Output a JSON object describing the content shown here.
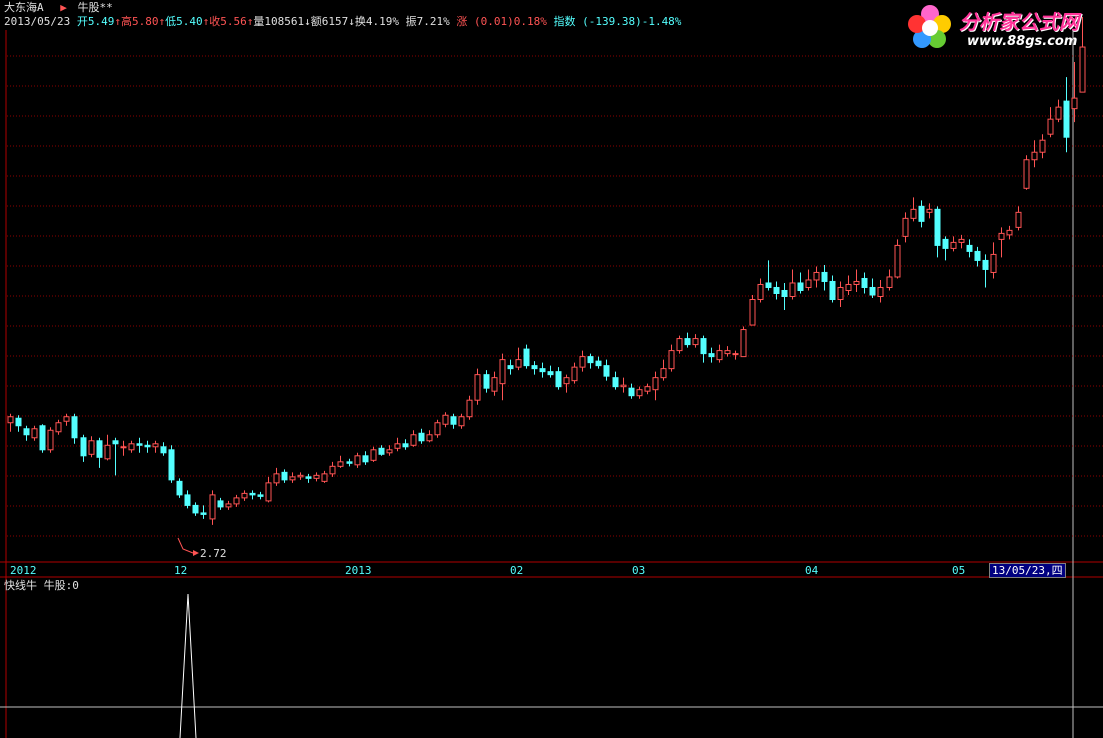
{
  "header": {
    "stock_name": "大东海A",
    "indicator_name": "牛股**",
    "date": "2013/05/23",
    "open_label": "开",
    "open": "5.49",
    "high_label": "高",
    "high": "5.80",
    "low_label": "低",
    "low": "5.40",
    "close_label": "收",
    "close": "5.56",
    "volume_label": "量",
    "volume": "108561",
    "amount_label": "额",
    "amount": "6157",
    "turnover_label": "换",
    "turnover": "4.19%",
    "amplitude_label": "振",
    "amplitude": "7.21%",
    "change_label": "涨",
    "change": "(0.01)0.18%",
    "index_label": "指数",
    "index": "(-139.38)-1.48%"
  },
  "logo": {
    "name": "分析家公式网",
    "url": "www.88gs.com"
  },
  "price_chart": {
    "low_marker": "2.72",
    "x_axis_labels": [
      "2012",
      "12",
      "2013",
      "02",
      "03",
      "04",
      "05"
    ],
    "cursor_label": "13/05/23,四",
    "colors": {
      "up": "#ff5454",
      "down": "#54ffff",
      "grid": "#8b0000",
      "frame": "#b00000"
    }
  },
  "sub_chart": {
    "indicator": "快线牛",
    "line_label": "牛股:",
    "line_value": "0"
  },
  "chart_data": {
    "type": "candlestick",
    "ylim": [
      2.5,
      6.0
    ],
    "candles": [
      [
        3.4,
        3.44,
        3.46,
        3.34
      ],
      [
        3.43,
        3.38,
        3.45,
        3.34
      ],
      [
        3.36,
        3.32,
        3.38,
        3.28
      ],
      [
        3.3,
        3.36,
        3.38,
        3.28
      ],
      [
        3.38,
        3.22,
        3.39,
        3.2
      ],
      [
        3.22,
        3.35,
        3.37,
        3.2
      ],
      [
        3.34,
        3.4,
        3.42,
        3.32
      ],
      [
        3.41,
        3.44,
        3.46,
        3.38
      ],
      [
        3.44,
        3.3,
        3.46,
        3.26
      ],
      [
        3.3,
        3.18,
        3.32,
        3.14
      ],
      [
        3.19,
        3.28,
        3.31,
        3.17
      ],
      [
        3.28,
        3.17,
        3.3,
        3.1
      ],
      [
        3.16,
        3.25,
        3.32,
        3.15
      ],
      [
        3.28,
        3.26,
        3.3,
        3.05
      ],
      [
        3.24,
        3.24,
        3.28,
        3.18
      ],
      [
        3.22,
        3.26,
        3.28,
        3.2
      ],
      [
        3.26,
        3.25,
        3.3,
        3.2
      ],
      [
        3.25,
        3.24,
        3.28,
        3.2
      ],
      [
        3.24,
        3.26,
        3.28,
        3.2
      ],
      [
        3.24,
        3.2,
        3.27,
        3.18
      ],
      [
        3.22,
        3.02,
        3.25,
        3.0
      ],
      [
        3.01,
        2.92,
        3.03,
        2.9
      ],
      [
        2.92,
        2.85,
        2.95,
        2.83
      ],
      [
        2.85,
        2.8,
        2.87,
        2.78
      ],
      [
        2.8,
        2.79,
        2.85,
        2.76
      ],
      [
        2.76,
        2.92,
        2.95,
        2.72
      ],
      [
        2.88,
        2.84,
        2.9,
        2.82
      ],
      [
        2.84,
        2.86,
        2.88,
        2.82
      ],
      [
        2.86,
        2.9,
        2.92,
        2.84
      ],
      [
        2.9,
        2.93,
        2.95,
        2.88
      ],
      [
        2.93,
        2.92,
        2.95,
        2.89
      ],
      [
        2.92,
        2.91,
        2.94,
        2.89
      ],
      [
        2.88,
        3.0,
        3.04,
        2.87
      ],
      [
        3.0,
        3.06,
        3.1,
        2.98
      ],
      [
        3.07,
        3.02,
        3.09,
        3.0
      ],
      [
        3.02,
        3.04,
        3.07,
        3.0
      ],
      [
        3.04,
        3.05,
        3.07,
        3.02
      ],
      [
        3.04,
        3.03,
        3.06,
        3.0
      ],
      [
        3.03,
        3.05,
        3.07,
        3.01
      ],
      [
        3.01,
        3.06,
        3.08,
        3.0
      ],
      [
        3.06,
        3.11,
        3.14,
        3.04
      ],
      [
        3.11,
        3.14,
        3.18,
        3.1
      ],
      [
        3.14,
        3.13,
        3.16,
        3.11
      ],
      [
        3.12,
        3.18,
        3.2,
        3.1
      ],
      [
        3.18,
        3.14,
        3.21,
        3.12
      ],
      [
        3.15,
        3.22,
        3.24,
        3.14
      ],
      [
        3.23,
        3.19,
        3.25,
        3.18
      ],
      [
        3.2,
        3.22,
        3.25,
        3.18
      ],
      [
        3.23,
        3.26,
        3.3,
        3.21
      ],
      [
        3.26,
        3.24,
        3.29,
        3.22
      ],
      [
        3.25,
        3.32,
        3.35,
        3.24
      ],
      [
        3.33,
        3.28,
        3.36,
        3.26
      ],
      [
        3.28,
        3.32,
        3.35,
        3.27
      ],
      [
        3.32,
        3.4,
        3.42,
        3.3
      ],
      [
        3.39,
        3.45,
        3.47,
        3.37
      ],
      [
        3.44,
        3.39,
        3.46,
        3.36
      ],
      [
        3.38,
        3.44,
        3.46,
        3.36
      ],
      [
        3.44,
        3.55,
        3.58,
        3.42
      ],
      [
        3.55,
        3.72,
        3.76,
        3.52
      ],
      [
        3.72,
        3.63,
        3.75,
        3.6
      ],
      [
        3.61,
        3.7,
        3.74,
        3.58
      ],
      [
        3.66,
        3.82,
        3.86,
        3.55
      ],
      [
        3.78,
        3.76,
        3.82,
        3.72
      ],
      [
        3.77,
        3.82,
        3.9,
        3.75
      ],
      [
        3.89,
        3.78,
        3.92,
        3.76
      ],
      [
        3.78,
        3.76,
        3.81,
        3.72
      ],
      [
        3.76,
        3.74,
        3.8,
        3.7
      ],
      [
        3.74,
        3.72,
        3.78,
        3.7
      ],
      [
        3.74,
        3.64,
        3.77,
        3.62
      ],
      [
        3.66,
        3.7,
        3.72,
        3.6
      ],
      [
        3.68,
        3.77,
        3.8,
        3.66
      ],
      [
        3.77,
        3.84,
        3.88,
        3.74
      ],
      [
        3.84,
        3.8,
        3.86,
        3.76
      ],
      [
        3.81,
        3.78,
        3.84,
        3.76
      ],
      [
        3.78,
        3.71,
        3.82,
        3.68
      ],
      [
        3.7,
        3.64,
        3.74,
        3.62
      ],
      [
        3.64,
        3.65,
        3.7,
        3.6
      ],
      [
        3.63,
        3.58,
        3.66,
        3.56
      ],
      [
        3.58,
        3.62,
        3.64,
        3.56
      ],
      [
        3.61,
        3.64,
        3.66,
        3.59
      ],
      [
        3.62,
        3.7,
        3.74,
        3.55
      ],
      [
        3.7,
        3.76,
        3.82,
        3.68
      ],
      [
        3.76,
        3.88,
        3.92,
        3.74
      ],
      [
        3.88,
        3.96,
        3.98,
        3.86
      ],
      [
        3.96,
        3.92,
        4.0,
        3.9
      ],
      [
        3.92,
        3.96,
        3.99,
        3.9
      ],
      [
        3.96,
        3.86,
        3.98,
        3.8
      ],
      [
        3.86,
        3.84,
        3.9,
        3.8
      ],
      [
        3.82,
        3.88,
        3.92,
        3.8
      ],
      [
        3.86,
        3.88,
        3.91,
        3.84
      ],
      [
        3.86,
        3.86,
        3.88,
        3.82
      ],
      [
        3.84,
        4.02,
        4.04,
        3.84
      ],
      [
        4.05,
        4.22,
        4.25,
        4.05
      ],
      [
        4.22,
        4.32,
        4.36,
        4.2
      ],
      [
        4.33,
        4.3,
        4.48,
        4.28
      ],
      [
        4.3,
        4.26,
        4.34,
        4.22
      ],
      [
        4.28,
        4.24,
        4.33,
        4.15
      ],
      [
        4.24,
        4.33,
        4.42,
        4.22
      ],
      [
        4.33,
        4.28,
        4.4,
        4.26
      ],
      [
        4.3,
        4.35,
        4.42,
        4.28
      ],
      [
        4.35,
        4.4,
        4.44,
        4.3
      ],
      [
        4.4,
        4.34,
        4.45,
        4.28
      ],
      [
        4.34,
        4.22,
        4.38,
        4.2
      ],
      [
        4.22,
        4.3,
        4.34,
        4.17
      ],
      [
        4.28,
        4.32,
        4.38,
        4.25
      ],
      [
        4.32,
        4.34,
        4.42,
        4.27
      ],
      [
        4.36,
        4.3,
        4.4,
        4.26
      ],
      [
        4.3,
        4.25,
        4.36,
        4.23
      ],
      [
        4.24,
        4.3,
        4.35,
        4.2
      ],
      [
        4.3,
        4.37,
        4.42,
        4.28
      ],
      [
        4.37,
        4.58,
        4.62,
        4.36
      ],
      [
        4.64,
        4.76,
        4.8,
        4.6
      ],
      [
        4.76,
        4.82,
        4.9,
        4.74
      ],
      [
        4.84,
        4.74,
        4.88,
        4.7
      ],
      [
        4.8,
        4.82,
        4.86,
        4.76
      ],
      [
        4.82,
        4.58,
        4.84,
        4.5
      ],
      [
        4.62,
        4.56,
        4.64,
        4.48
      ],
      [
        4.56,
        4.6,
        4.64,
        4.54
      ],
      [
        4.6,
        4.62,
        4.65,
        4.56
      ],
      [
        4.58,
        4.54,
        4.62,
        4.5
      ],
      [
        4.54,
        4.48,
        4.57,
        4.44
      ],
      [
        4.48,
        4.42,
        4.52,
        4.3
      ],
      [
        4.4,
        4.52,
        4.6,
        4.36
      ],
      [
        4.62,
        4.66,
        4.7,
        4.5
      ],
      [
        4.65,
        4.68,
        4.71,
        4.62
      ],
      [
        4.7,
        4.8,
        4.84,
        4.68
      ],
      [
        4.96,
        5.15,
        5.18,
        4.95
      ],
      [
        5.15,
        5.2,
        5.28,
        5.1
      ],
      [
        5.2,
        5.28,
        5.32,
        5.16
      ],
      [
        5.32,
        5.42,
        5.5,
        5.3
      ],
      [
        5.42,
        5.5,
        5.55,
        5.4
      ],
      [
        5.54,
        5.3,
        5.7,
        5.2
      ],
      [
        5.49,
        5.56,
        5.8,
        5.4
      ],
      [
        5.6,
        5.9,
        6.1,
        5.7
      ]
    ]
  }
}
